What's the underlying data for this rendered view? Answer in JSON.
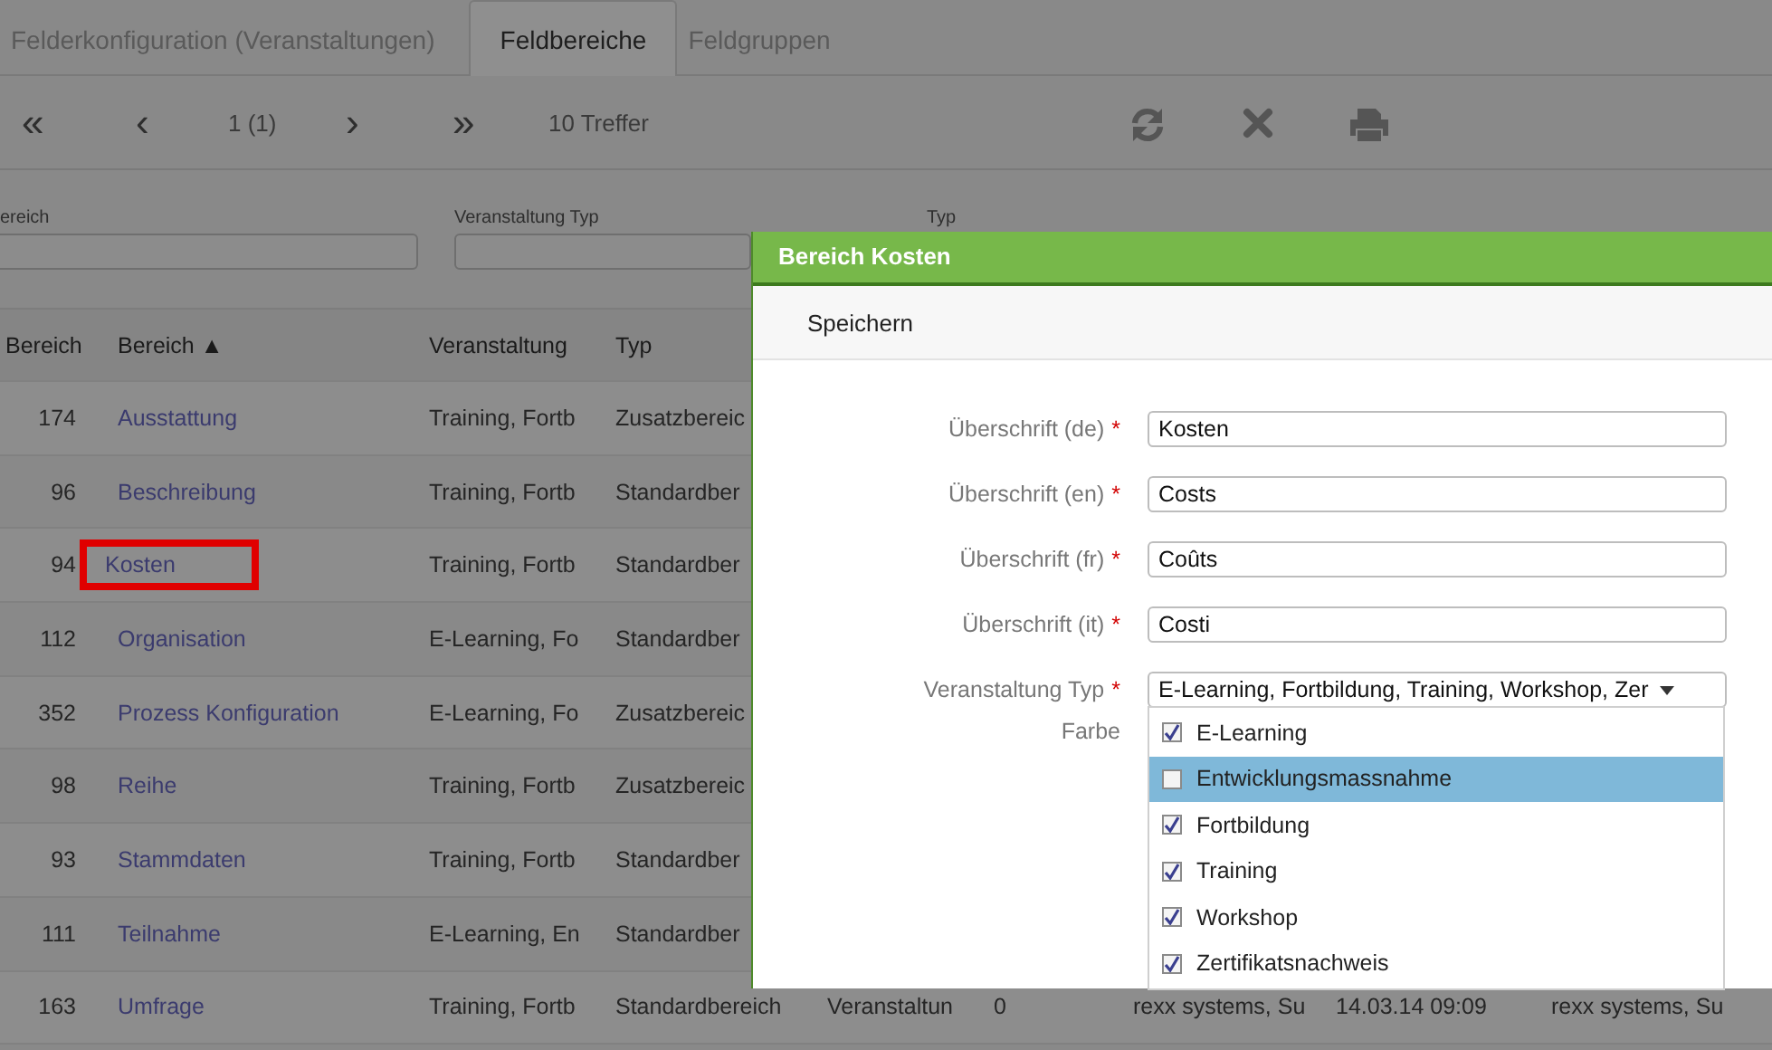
{
  "tabs": [
    {
      "label": "Felderkonfiguration (Veranstaltungen)",
      "selected": false
    },
    {
      "label": "Feldbereiche",
      "selected": true
    },
    {
      "label": "Feldgruppen",
      "selected": false
    }
  ],
  "pager": {
    "first": "«",
    "previous": "‹",
    "page": "1 (1)",
    "next": "›",
    "last": "»",
    "hits": "10 Treffer"
  },
  "filters": [
    {
      "label": "ereich"
    },
    {
      "label": "Veranstaltung Typ"
    },
    {
      "label": "Typ"
    }
  ],
  "table": {
    "columns": [
      "Bereich",
      "Bereich ▲",
      "Veranstaltung",
      "Typ"
    ],
    "rows": [
      {
        "marked": false,
        "cells": [
          "174",
          "Ausstattung",
          "Training, Fortb",
          "Zusatzbereic"
        ]
      },
      {
        "marked": false,
        "cells": [
          "96",
          "Beschreibung",
          "Training, Fortb",
          "Standardber"
        ]
      },
      {
        "marked": true,
        "cells": [
          "94",
          "Kosten",
          "Training, Fortb",
          "Standardber"
        ]
      },
      {
        "marked": false,
        "cells": [
          "112",
          "Organisation",
          "E-Learning, Fo",
          "Standardber"
        ]
      },
      {
        "marked": false,
        "cells": [
          "352",
          "Prozess Konfiguration",
          "E-Learning, Fo",
          "Zusatzbereic"
        ]
      },
      {
        "marked": false,
        "cells": [
          "98",
          "Reihe",
          "Training, Fortb",
          "Zusatzbereic"
        ]
      },
      {
        "marked": false,
        "cells": [
          "93",
          "Stammdaten",
          "Training, Fortb",
          "Standardber"
        ]
      },
      {
        "marked": false,
        "cells": [
          "111",
          "Teilnahme",
          "E-Learning, En",
          "Standardber"
        ]
      },
      {
        "marked": false,
        "cells": [
          "163",
          "Umfrage",
          "Training, Fortb",
          "Standardbereich",
          "Veranstaltun",
          "0",
          "rexx systems, Su",
          "14.03.14 09:09",
          "rexx systems, Su"
        ]
      }
    ]
  },
  "dialog": {
    "title": "Bereich Kosten",
    "save": "Speichern",
    "fields": [
      {
        "label": "Überschrift (de)",
        "required_mark": "*",
        "value": "Kosten"
      },
      {
        "label": "Überschrift (en)",
        "required_mark": "*",
        "value": "Costs"
      },
      {
        "label": "Überschrift (fr)",
        "required_mark": "*",
        "value": "Coûts"
      },
      {
        "label": "Überschrift (it)",
        "required_mark": "*",
        "value": "Costi"
      }
    ],
    "select": {
      "label": "Veranstaltung Typ",
      "required_mark": "*",
      "value": "E-Learning, Fortbildung, Training, Workshop, Zer",
      "options": [
        {
          "label": "E-Learning",
          "checked": true,
          "highlighted": false
        },
        {
          "label": "Entwicklungsmassnahme",
          "checked": false,
          "highlighted": true
        },
        {
          "label": "Fortbildung",
          "checked": true,
          "highlighted": false
        },
        {
          "label": "Training",
          "checked": true,
          "highlighted": false
        },
        {
          "label": "Workshop",
          "checked": true,
          "highlighted": false
        },
        {
          "label": "Zertifikatsnachweis",
          "checked": true,
          "highlighted": false
        }
      ]
    },
    "color_label": "Farbe"
  }
}
